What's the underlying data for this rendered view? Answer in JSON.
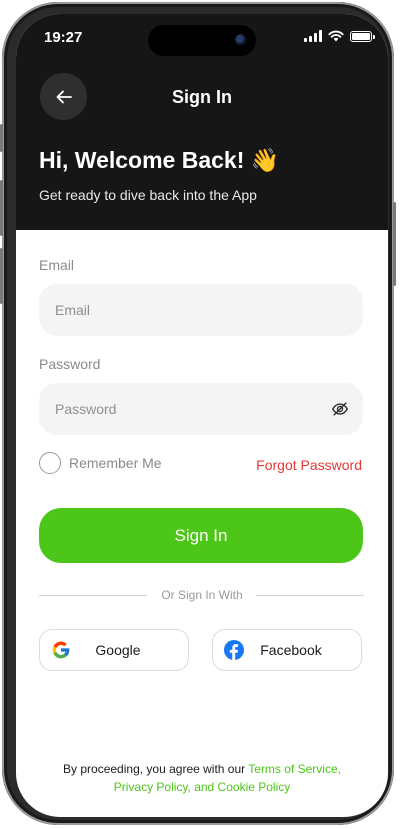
{
  "status_bar": {
    "time": "19:27"
  },
  "header": {
    "title": "Sign In",
    "welcome": "Hi, Welcome Back! 👋",
    "subtitle": "Get ready to dive back into the App"
  },
  "form": {
    "email_label": "Email",
    "email_placeholder": "Email",
    "email_value": "",
    "password_label": "Password",
    "password_placeholder": "Password",
    "password_value": "",
    "remember_me": "Remember Me",
    "remember_checked": false,
    "forgot_password": "Forgot Password",
    "signin_button": "Sign In"
  },
  "social": {
    "divider_text": "Or Sign In With",
    "google": "Google",
    "facebook": "Facebook"
  },
  "terms": {
    "prefix": "By proceeding, you agree with our ",
    "link_text": "Terms of Service, Privacy Policy, and Cookie Policy"
  },
  "colors": {
    "accent": "#4dc61a",
    "danger": "#e53935",
    "header_bg": "#161616",
    "field_bg": "#f4f4f4"
  }
}
